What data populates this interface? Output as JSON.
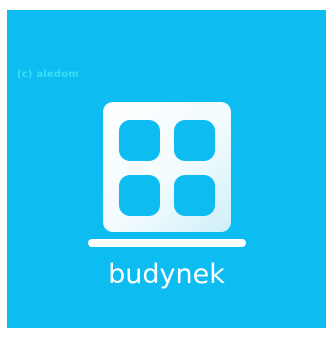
{
  "watermark": {
    "text": "(c) aledom"
  },
  "brand": {
    "name": "budynek",
    "icon": "building-window-grid-icon"
  },
  "colors": {
    "background": "#0dbcf0",
    "foreground": "#ffffff",
    "watermark": "#38e0f2"
  }
}
